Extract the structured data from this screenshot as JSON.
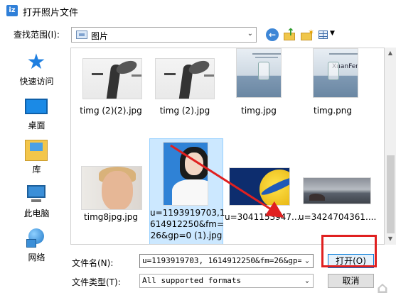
{
  "window": {
    "title": "打开照片文件",
    "app_icon_text": "iz"
  },
  "lookin": {
    "label": "查找范围(I):",
    "value": "图片"
  },
  "toolbar": {
    "back_label": "←",
    "view_menu_arrow": "▼"
  },
  "places": [
    {
      "label": "快速访问",
      "icon": "star-icon"
    },
    {
      "label": "桌面",
      "icon": "desktop-icon"
    },
    {
      "label": "库",
      "icon": "library-icon"
    },
    {
      "label": "此电脑",
      "icon": "computer-icon"
    },
    {
      "label": "网络",
      "icon": "network-icon"
    }
  ],
  "files": [
    {
      "name": "timg (2)(2).jpg"
    },
    {
      "name": "timg (2).jpg"
    },
    {
      "name": "timg.jpg"
    },
    {
      "name": "timg.png",
      "thumb_text": "XuanFeng"
    },
    {
      "name": "timg8jpg.jpg"
    },
    {
      "name": "u=1193919703,1614912250&fm=26&gp=0 (1).jpg",
      "name_lines": [
        "u=1193919703,1",
        "614912250&fm=",
        "26&gp=0 (1).jpg"
      ],
      "selected": true
    },
    {
      "name": "u=3041153947...."
    },
    {
      "name": "u=3424704361...."
    }
  ],
  "form": {
    "filename_label": "文件名(N):",
    "filename_value": "u=1193919703, 1614912250&fm=26&gp=0 (1",
    "filetype_label": "文件类型(T):",
    "filetype_value": "All supported formats",
    "open_label": "打开(O)",
    "cancel_label": "取消"
  },
  "colors": {
    "accent": "#0078d7",
    "selection": "#cce8ff",
    "annotation_red": "#e02020"
  }
}
